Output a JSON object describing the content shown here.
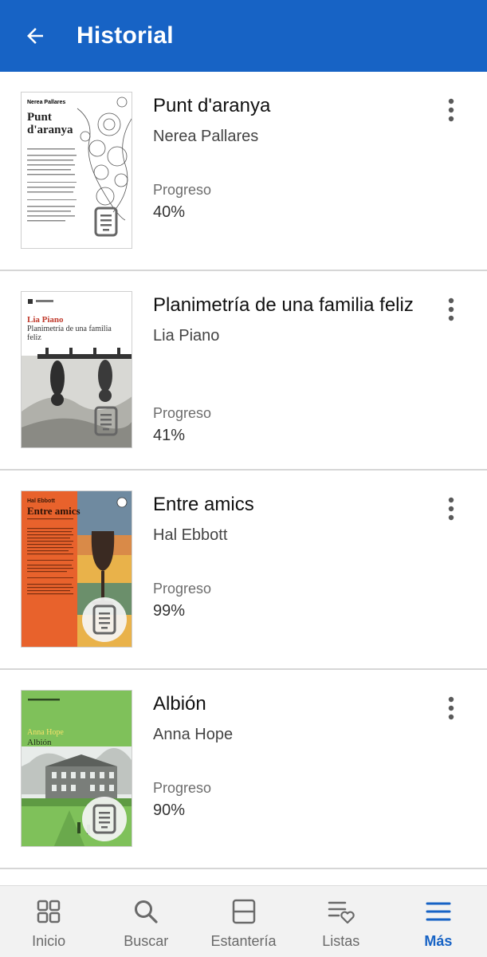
{
  "header": {
    "title": "Historial",
    "back_icon": "arrow-back-icon"
  },
  "progress_label": "Progreso",
  "books": [
    {
      "title": "Punt d'aranya",
      "author": "Nerea Pallares",
      "progress": "40%",
      "cover": {
        "author": "Nerea Pallares",
        "title": "Punt d'aranya",
        "bg": "#ffffff"
      }
    },
    {
      "title": "Planimetría de una familia feliz",
      "author": "Lia Piano",
      "progress": "41%",
      "cover": {
        "author": "Lia Piano",
        "title": "Planimetría de una familia feliz",
        "bg": "#ffffff"
      }
    },
    {
      "title": "Entre amics",
      "author": "Hal Ebbott",
      "progress": "99%",
      "cover": {
        "author": "Hal Ebbott",
        "title": "Entre amics",
        "bg": "#e8622c"
      }
    },
    {
      "title": "Albión",
      "author": "Anna Hope",
      "progress": "90%",
      "cover": {
        "author": "Anna Hope",
        "title": "Albión",
        "bg": "#7fc15a"
      }
    }
  ],
  "nav": {
    "items": [
      {
        "label": "Inicio",
        "icon": "grid-icon"
      },
      {
        "label": "Buscar",
        "icon": "search-icon"
      },
      {
        "label": "Estantería",
        "icon": "shelf-icon"
      },
      {
        "label": "Listas",
        "icon": "list-heart-icon"
      },
      {
        "label": "Más",
        "icon": "menu-icon"
      }
    ],
    "active": "Más"
  },
  "colors": {
    "primary": "#1763c5",
    "divider": "#d6d6d6",
    "nav_bg": "#f2f2f2"
  }
}
